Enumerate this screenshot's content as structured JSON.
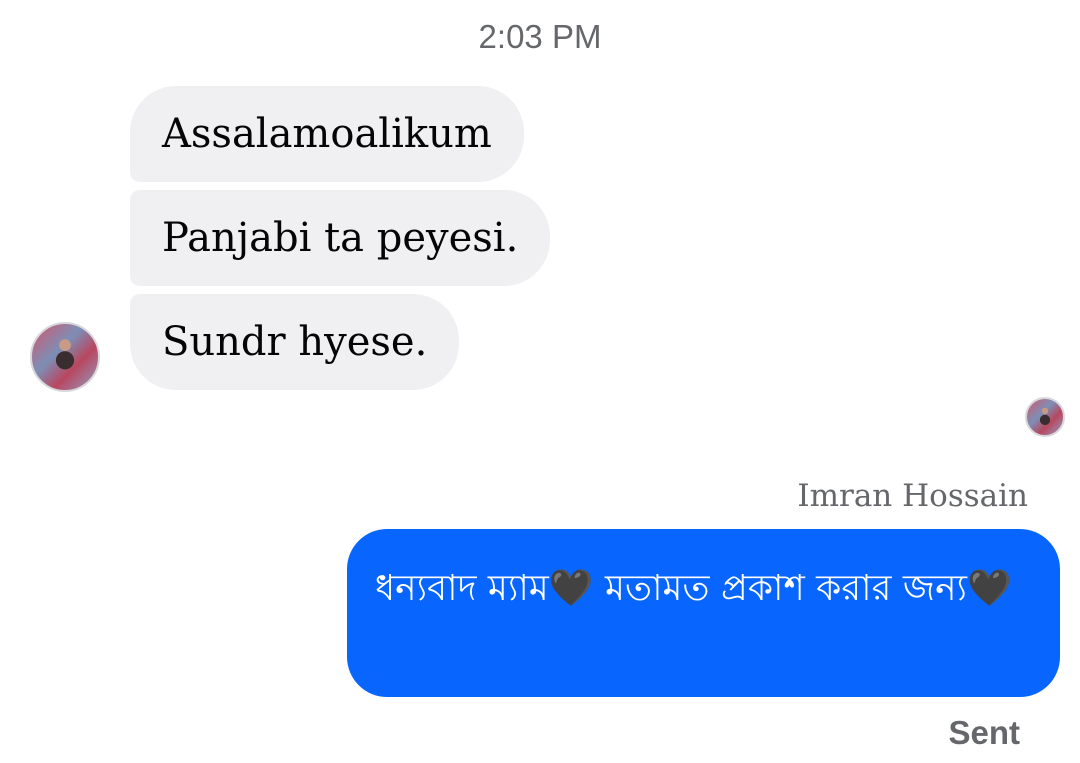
{
  "chat": {
    "timestamp": "2:03 PM",
    "incoming_messages": [
      "Assalamoalikum",
      "Panjabi ta peyesi.",
      "Sundr hyese."
    ],
    "outgoing": {
      "sender_name": "Imran Hossain",
      "message": "ধন্যবাদ ম্যাম🖤 মতামত প্রকাশ করার জন্য🖤",
      "status": "Sent"
    }
  },
  "colors": {
    "incoming_bubble": "#f0f0f3",
    "outgoing_bubble": "#0866ff",
    "meta_text": "#65676b"
  },
  "icons": {
    "contact_avatar": "contact-avatar",
    "read_receipt_avatar": "read-receipt-avatar"
  }
}
